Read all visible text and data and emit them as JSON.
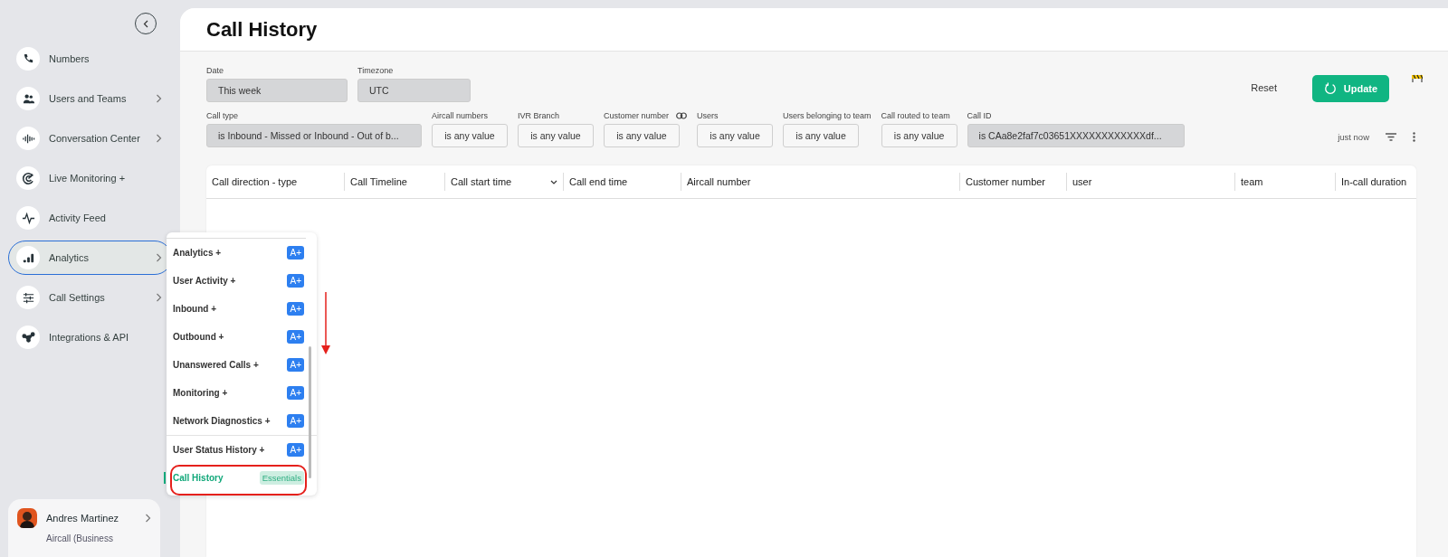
{
  "sidebar": {
    "items": [
      {
        "label": "Numbers",
        "chevron": false,
        "selected": false
      },
      {
        "label": "Users and Teams",
        "chevron": true,
        "selected": false
      },
      {
        "label": "Conversation Center",
        "chevron": true,
        "selected": false
      },
      {
        "label": "Live Monitoring +",
        "chevron": false,
        "selected": false
      },
      {
        "label": "Activity Feed",
        "chevron": false,
        "selected": false
      },
      {
        "label": "Analytics",
        "chevron": true,
        "selected": true
      },
      {
        "label": "Call Settings",
        "chevron": true,
        "selected": false
      },
      {
        "label": "Integrations & API",
        "chevron": false,
        "selected": false
      }
    ],
    "user": {
      "name": "Andres Martinez",
      "account": "Aircall (Business"
    }
  },
  "analytics_menu": [
    {
      "label": "Analytics +",
      "badge": "A+",
      "kind": "plus",
      "selected": false,
      "divider_after": false
    },
    {
      "label": "User Activity +",
      "badge": "A+",
      "kind": "plus",
      "selected": false,
      "divider_after": false
    },
    {
      "label": "Inbound +",
      "badge": "A+",
      "kind": "plus",
      "selected": false,
      "divider_after": false
    },
    {
      "label": "Outbound +",
      "badge": "A+",
      "kind": "plus",
      "selected": false,
      "divider_after": false
    },
    {
      "label": "Unanswered Calls +",
      "badge": "A+",
      "kind": "plus",
      "selected": false,
      "divider_after": false
    },
    {
      "label": "Monitoring +",
      "badge": "A+",
      "kind": "plus",
      "selected": false,
      "divider_after": false
    },
    {
      "label": "Network Diagnostics +",
      "badge": "A+",
      "kind": "plus",
      "selected": false,
      "divider_after": true
    },
    {
      "label": "User Status History +",
      "badge": "A+",
      "kind": "plus",
      "selected": false,
      "divider_after": false
    },
    {
      "label": "Call History",
      "badge": "Essentials",
      "kind": "essentials",
      "selected": true,
      "divider_after": false
    }
  ],
  "page": {
    "title": "Call History"
  },
  "filters_top": [
    {
      "label": "Date",
      "value": "This week",
      "kind": "filled"
    },
    {
      "label": "Timezone",
      "value": "UTC",
      "kind": "filled"
    }
  ],
  "actions": {
    "reset": "Reset",
    "update": "Update"
  },
  "filters": [
    {
      "label": "Call type",
      "value": "is Inbound - Missed or Inbound - Out of b...",
      "kind": "filled",
      "link": false
    },
    {
      "label": "Aircall numbers",
      "value": "is any value",
      "kind": "outline",
      "link": false
    },
    {
      "label": "IVR Branch",
      "value": "is any value",
      "kind": "outline",
      "link": false
    },
    {
      "label": "Customer number",
      "value": "is any value",
      "kind": "outline",
      "link": true
    },
    {
      "label": "Users",
      "value": "is any value",
      "kind": "outline",
      "link": false
    },
    {
      "label": "Users belonging to team",
      "value": "is any value",
      "kind": "outline",
      "link": false
    },
    {
      "label": "Call routed to team",
      "value": "is any value",
      "kind": "outline",
      "link": false
    },
    {
      "label": "Call ID",
      "value": "is CAa8e2faf7c03651XXXXXXXXXXXXdf...",
      "kind": "filled",
      "link": false
    }
  ],
  "refresh": {
    "status": "just now"
  },
  "table": {
    "columns": [
      {
        "label": "Call direction - type",
        "sorted": false
      },
      {
        "label": "Call Timeline",
        "sorted": false
      },
      {
        "label": "Call start time",
        "sorted": true
      },
      {
        "label": "Call end time",
        "sorted": false
      },
      {
        "label": "Aircall number",
        "sorted": false
      },
      {
        "label": "Customer number",
        "sorted": false
      },
      {
        "label": "user",
        "sorted": false
      },
      {
        "label": "team",
        "sorted": false
      },
      {
        "label": "In-call duration",
        "sorted": false
      }
    ]
  }
}
